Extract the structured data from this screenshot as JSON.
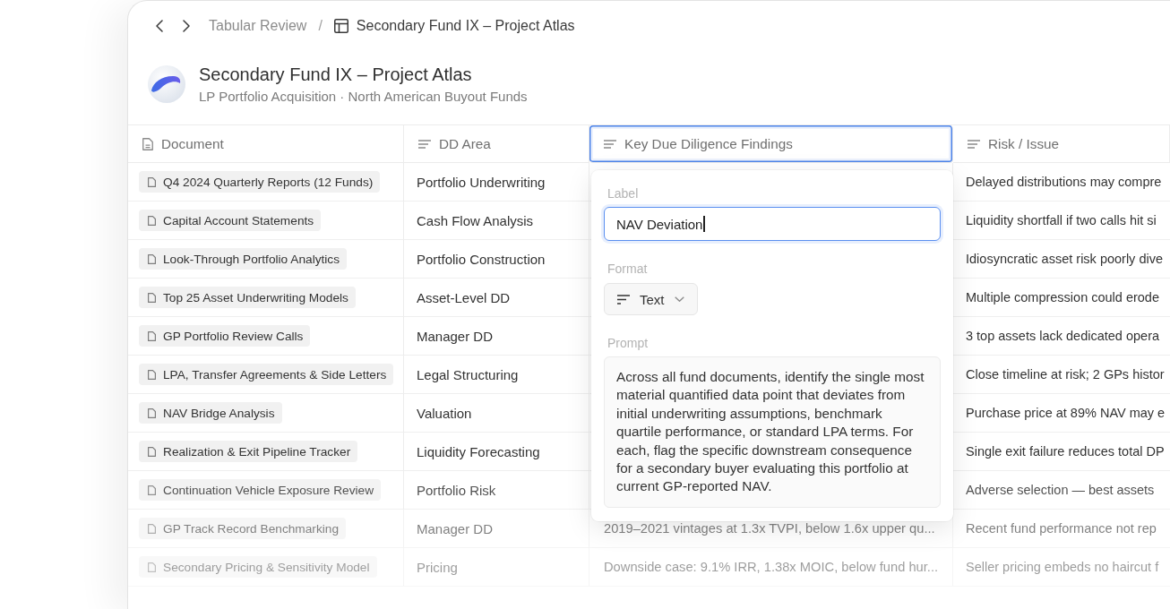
{
  "breadcrumb": {
    "separator": "/",
    "items": [
      {
        "label": "Tabular Review",
        "current": false
      },
      {
        "label": "Secondary Fund IX – Project Atlas",
        "current": true
      }
    ]
  },
  "project": {
    "title": "Secondary Fund IX – Project Atlas",
    "subtitle": "LP Portfolio Acquisition · North American Buyout Funds"
  },
  "table": {
    "columns": [
      {
        "label": "Document",
        "kind": "document",
        "selected": false
      },
      {
        "label": "DD Area",
        "kind": "text",
        "selected": false
      },
      {
        "label": "Key Due Diligence Findings",
        "kind": "text",
        "selected": true
      },
      {
        "label": "Risk / Issue",
        "kind": "text",
        "selected": false
      }
    ],
    "rows": [
      {
        "document": "Q4 2024 Quarterly Reports (12 Funds)",
        "dd_area": "Portfolio Underwriting",
        "risk": "Delayed distributions may compre"
      },
      {
        "document": "Capital Account Statements",
        "dd_area": "Cash Flow Analysis",
        "risk": "Liquidity shortfall if two calls hit si"
      },
      {
        "document": "Look-Through Portfolio Analytics",
        "dd_area": "Portfolio Construction",
        "risk": "Idiosyncratic asset risk poorly dive"
      },
      {
        "document": "Top 25 Asset Underwriting Models",
        "dd_area": "Asset-Level DD",
        "risk": "Multiple compression could erode"
      },
      {
        "document": "GP Portfolio Review Calls",
        "dd_area": "Manager DD",
        "risk": "3 top assets lack dedicated opera"
      },
      {
        "document": "LPA, Transfer Agreements & Side Letters",
        "dd_area": "Legal Structuring",
        "risk": "Close timeline at risk; 2 GPs histor"
      },
      {
        "document": "NAV Bridge Analysis",
        "dd_area": "Valuation",
        "risk": "Purchase price at 89% NAV may e"
      },
      {
        "document": "Realization & Exit Pipeline Tracker",
        "dd_area": "Liquidity Forecasting",
        "risk": "Single exit failure reduces total DP"
      },
      {
        "document": "Continuation Vehicle Exposure Review",
        "dd_area": "Portfolio Risk",
        "risk": "Adverse selection — best assets"
      },
      {
        "document": "GP Track Record Benchmarking",
        "dd_area": "Manager DD",
        "finding": "2019–2021 vintages at 1.3x TVPI, below 1.6x upper qu...",
        "risk": "Recent fund performance not rep"
      },
      {
        "document": "Secondary Pricing & Sensitivity Model",
        "dd_area": "Pricing",
        "finding": "Downside case: 9.1% IRR, 1.38x MOIC, below fund hur...",
        "risk": "Seller pricing embeds no haircut f"
      }
    ]
  },
  "column_editor": {
    "label": {
      "title": "Label",
      "value": "NAV Deviation",
      "focused": true
    },
    "format": {
      "title": "Format",
      "value": "Text"
    },
    "prompt": {
      "title": "Prompt",
      "value": "Across all fund documents, identify the single most material quantified data point that deviates from initial underwriting assumptions, benchmark quartile performance, or standard LPA terms. For each, flag the specific downstream consequence for a secondary buyer evaluating this portfolio at current GP-reported NAV."
    }
  }
}
